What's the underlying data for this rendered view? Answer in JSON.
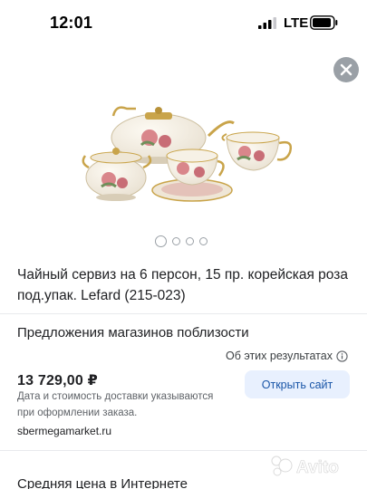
{
  "status_bar": {
    "time": "12:01",
    "network": "LTE"
  },
  "product": {
    "title": "Чайный сервиз на 6 персон, 15 пр. корейская роза под.упак. Lefard (215-023)",
    "image_icon": "tea-set-image",
    "carousel": {
      "count": 4,
      "active": 0
    }
  },
  "offers": {
    "heading": "Предложения магазинов поблизости",
    "about_results": "Об этих результатах",
    "price": "13 729,00 ₽",
    "delivery_note": "Дата и стоимость доставки указываются при оформлении заказа.",
    "open_site_label": "Открыть сайт",
    "shop_domain": "sbermegamarket.ru"
  },
  "avg_price": {
    "heading": "Средняя цена в Интернете"
  },
  "watermark": {
    "text": "Avito"
  },
  "colors": {
    "accent_button_bg": "#e8f0fe",
    "accent_button_text": "#1a56a8",
    "close_button_bg": "#9aa0a6"
  }
}
